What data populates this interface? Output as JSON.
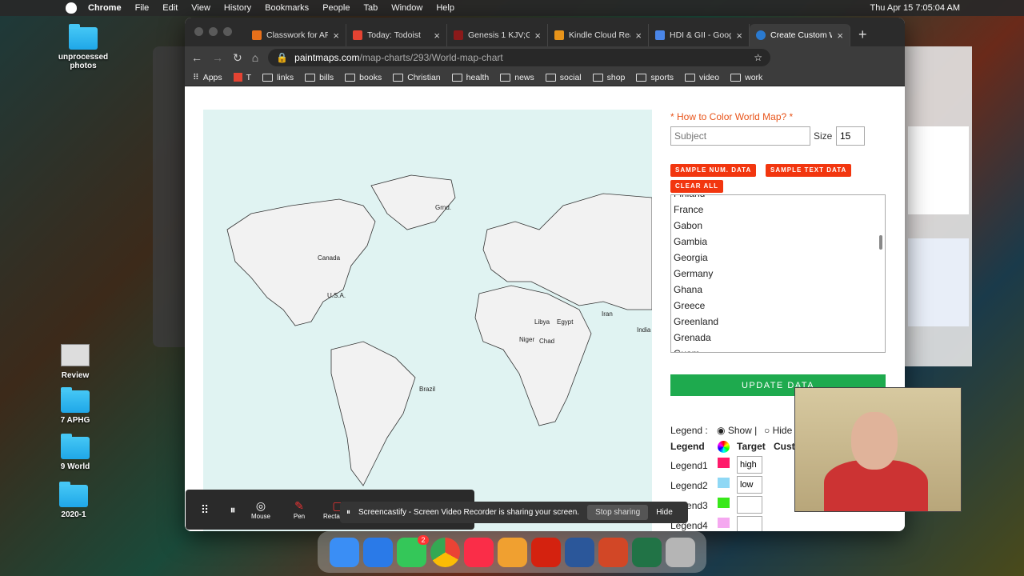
{
  "menubar": {
    "app": "Chrome",
    "items": [
      "File",
      "Edit",
      "View",
      "History",
      "Bookmarks",
      "People",
      "Tab",
      "Window",
      "Help"
    ],
    "clock": "Thu Apr 15  7:05:04 AM"
  },
  "desktop": {
    "icons": [
      {
        "label": "unprocessed photos"
      },
      {
        "label": "Review"
      },
      {
        "label": "7 APHG"
      },
      {
        "label": "9 World"
      },
      {
        "label": "2020-1"
      }
    ]
  },
  "tabs": [
    {
      "label": "Classwork for AP",
      "color": "#e8701a"
    },
    {
      "label": "Today: Todoist",
      "color": "#e44332"
    },
    {
      "label": "Genesis 1 KJV;G",
      "color": "#8b1a1a"
    },
    {
      "label": "Kindle Cloud Rea",
      "color": "#e8941a"
    },
    {
      "label": "HDI & GII - Goog",
      "color": "#4a86e8"
    },
    {
      "label": "Create Custom W",
      "color": "#2a7ad0"
    }
  ],
  "url": {
    "host": "paintmaps.com",
    "path": "/map-charts/293/World-map-chart"
  },
  "bookmarks": [
    "Apps",
    "T",
    "links",
    "bills",
    "books",
    "Christian",
    "health",
    "news",
    "social",
    "shop",
    "sports",
    "video",
    "work"
  ],
  "map": {
    "labels": [
      "Grnd.",
      "Canada",
      "U.S.A.",
      "Brazil",
      "Libya",
      "Egypt",
      "India",
      "Iran",
      "Niger",
      "Chad"
    ]
  },
  "form": {
    "how_label": "* How to Color World Map? *",
    "subject_placeholder": "Subject",
    "size_label": "Size",
    "size_value": "15",
    "buttons": [
      "SAMPLE NUM. DATA",
      "SAMPLE TEXT DATA",
      "CLEAR ALL"
    ],
    "countries": [
      "Finland",
      "France",
      "Gabon",
      "Gambia",
      "Georgia",
      "Germany",
      "Ghana",
      "Greece",
      "Greenland",
      "Grenada",
      "Guam"
    ],
    "update": "UPDATE DATA"
  },
  "legend": {
    "label": "Legend :",
    "show": "Show |",
    "hide": "Hide",
    "col_legend": "Legend",
    "col_target": "Target",
    "col_custom": "Cust",
    "rows": [
      {
        "name": "Legend1",
        "color": "#ff1a6a",
        "target": "high"
      },
      {
        "name": "Legend2",
        "color": "#8fd8f5",
        "target": "low"
      },
      {
        "name": "Legend3",
        "color": "#38e81a",
        "target": ""
      },
      {
        "name": "Legend4",
        "color": "#f5a8f0",
        "target": ""
      }
    ]
  },
  "screencastify": {
    "tools": [
      "Mouse",
      "Pen",
      "Rectangle"
    ],
    "message": "Screencastify - Screen Video Recorder is sharing your screen.",
    "stop": "Stop sharing",
    "hide": "Hide"
  },
  "dock": {
    "badge": "2"
  }
}
